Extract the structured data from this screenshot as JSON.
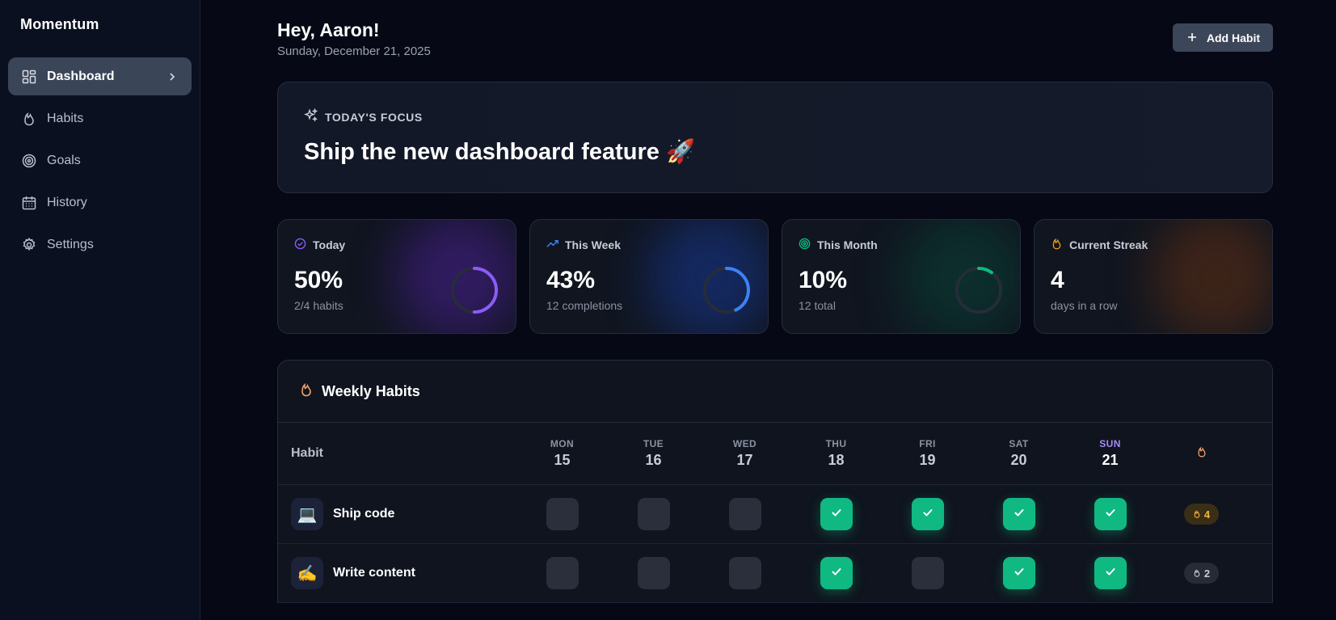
{
  "app": {
    "brand": "Momentum"
  },
  "sidebar": {
    "items": [
      {
        "label": "Dashboard",
        "icon": "dashboard-icon",
        "active": true
      },
      {
        "label": "Habits",
        "icon": "flame-icon"
      },
      {
        "label": "Goals",
        "icon": "target-icon"
      },
      {
        "label": "History",
        "icon": "calendar-icon"
      },
      {
        "label": "Settings",
        "icon": "gear-icon"
      }
    ]
  },
  "header": {
    "greeting": "Hey, Aaron!",
    "date": "Sunday, December 21, 2025",
    "add_label": "Add Habit"
  },
  "focus": {
    "label": "TODAY'S FOCUS",
    "title": "Ship the new dashboard feature 🚀"
  },
  "stats": [
    {
      "label": "Today",
      "value": "50%",
      "sub": "2/4 habits",
      "progress": 0.5,
      "color": "#8b5cf6"
    },
    {
      "label": "This Week",
      "value": "43%",
      "sub": "12 completions",
      "progress": 0.43,
      "color": "#3b82f6"
    },
    {
      "label": "This Month",
      "value": "10%",
      "sub": "12 total",
      "progress": 0.1,
      "color": "#10b981"
    },
    {
      "label": "Current Streak",
      "value": "4",
      "sub": "days in a row",
      "color": "#f59e0b"
    }
  ],
  "weekly": {
    "title": "Weekly Habits",
    "habit_header": "Habit",
    "days": [
      {
        "name": "MON",
        "num": "15"
      },
      {
        "name": "TUE",
        "num": "16"
      },
      {
        "name": "WED",
        "num": "17"
      },
      {
        "name": "THU",
        "num": "18"
      },
      {
        "name": "FRI",
        "num": "19"
      },
      {
        "name": "SAT",
        "num": "20"
      },
      {
        "name": "SUN",
        "num": "21",
        "today": true
      }
    ],
    "habits": [
      {
        "emoji": "💻",
        "name": "Ship code",
        "done": [
          false,
          false,
          false,
          true,
          true,
          true,
          true
        ],
        "streak": "4",
        "hot": true
      },
      {
        "emoji": "✍️",
        "name": "Write content",
        "done": [
          false,
          false,
          false,
          true,
          false,
          true,
          true
        ],
        "streak": "2",
        "hot": false
      }
    ]
  }
}
